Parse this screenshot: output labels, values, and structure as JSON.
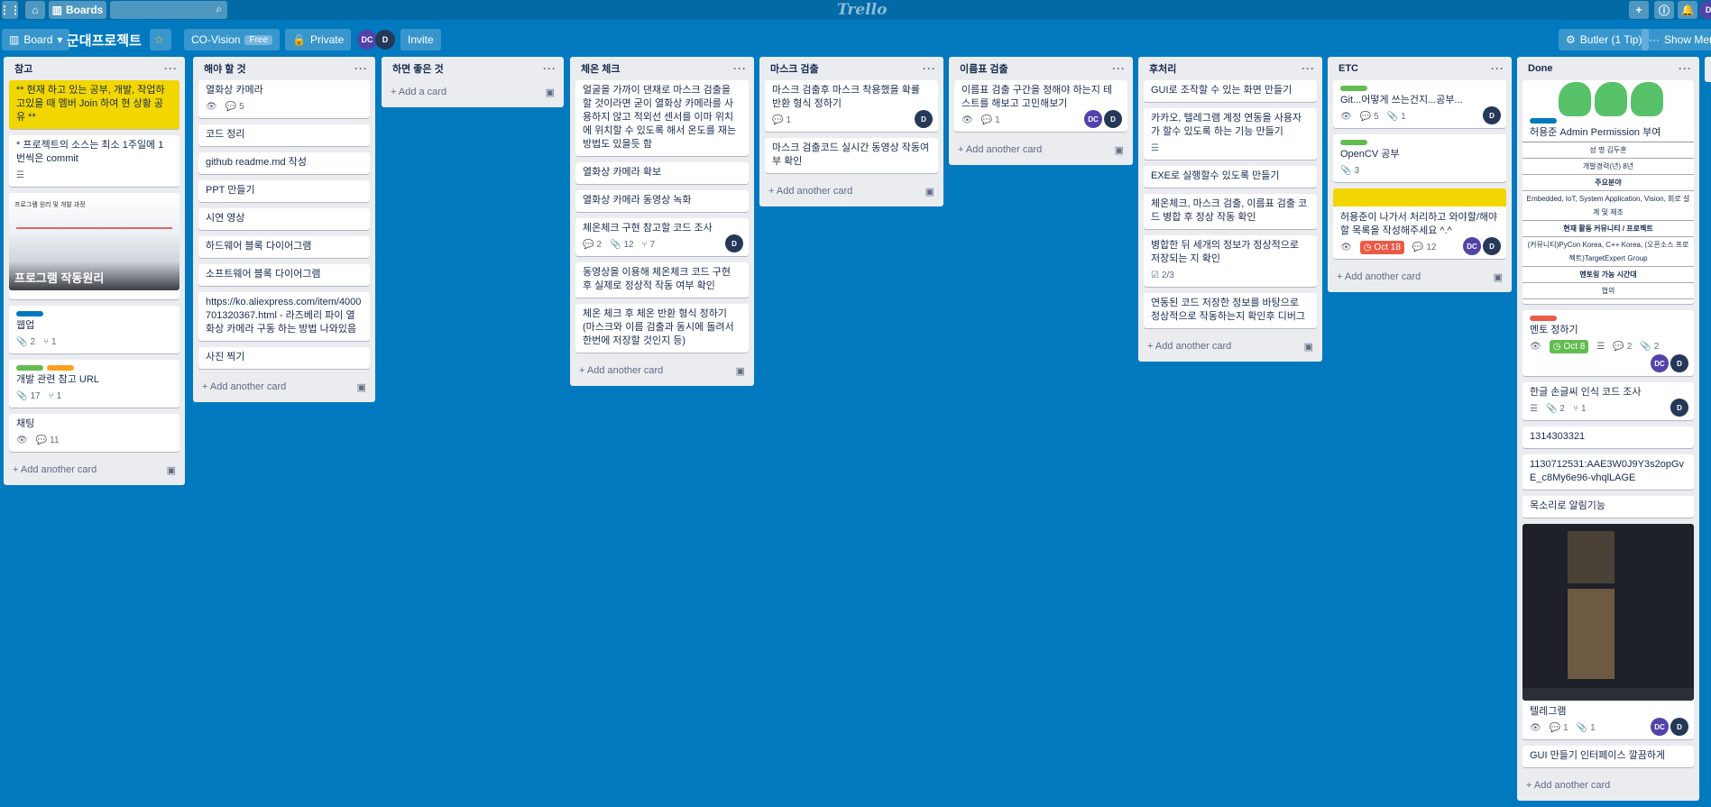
{
  "topbar": {
    "boards_label": "Boards",
    "logo": "Trello"
  },
  "board": {
    "view_label": "Board",
    "title": "군대프로젝트",
    "team": "CO-Vision",
    "team_badge": "Free",
    "privacy": "Private",
    "members": [
      "DC",
      "D"
    ],
    "invite": "Invite",
    "butler": "Butler (1 Tip)",
    "show_menu": "Show Menu"
  },
  "lists": [
    {
      "title": "참고",
      "add_label": "Add another card",
      "cards": [
        {
          "text": "** 현재 하고 있는 공부, 개발, 작업하고있을 때 멤버 Join 하여 현 상황 공유 **"
        },
        {
          "text": "* 프로젝트의 소스는 최소 1주일에 1번씩은 commit"
        },
        {
          "text": "",
          "cover_text": "프로그램 작동원리",
          "cover_title": "프로그램 원리 및 개발 과정"
        },
        {
          "text": "웹업",
          "badges": [
            "2",
            "1"
          ]
        },
        {
          "text": "개발 관련 참고 URL",
          "badges": [
            "17",
            "1"
          ]
        },
        {
          "text": "채팅",
          "badges": [
            "11"
          ]
        }
      ]
    },
    {
      "title": "해야 할 것",
      "add_label": "Add another card",
      "cards": [
        {
          "text": "열화상 카메라",
          "badges": [
            "5"
          ]
        },
        {
          "text": "코드 정리"
        },
        {
          "text": "github readme.md 작성"
        },
        {
          "text": "PPT 만들기"
        },
        {
          "text": "시연 영상"
        },
        {
          "text": "하드웨어 블록 다이어그램"
        },
        {
          "text": "소프트웨어 블록 다이어그램"
        },
        {
          "text": "https://ko.aliexpress.com/item/4000701320367.html - 라즈베리 파이 열화상 카메라 구동 하는 방법 나와있음"
        },
        {
          "text": "사진 찍기"
        }
      ]
    },
    {
      "title": "하면 좋은 것",
      "add_label": "Add a card",
      "cards": []
    },
    {
      "title": "체온 체크",
      "add_label": "Add another card",
      "cards": [
        {
          "text": "얼굴을 가까이 댄채로 마스크 검출을 할 것이라면 굳이 열화상 카메라를 사용하지 않고 적외선 센서를 이마 위치에 위치할 수 있도록 해서 온도를 재는 방법도 있을듯 함"
        },
        {
          "text": "열화상 카메라 확보"
        },
        {
          "text": "열화상 카메라 동영상 녹화"
        },
        {
          "text": "체온체크 구현 참고할 코드 조사",
          "badges": [
            "2",
            "12",
            "7"
          ],
          "member": "D"
        },
        {
          "text": "동영상을 이용해 체온체크 코드 구현 후 실제로 정상적 작동 여부 확인"
        },
        {
          "text": "체온 체크 후 체온 반환 형식 정하기 (마스크와 이름 검출과 동시에 돌려서 한번에 저장할 것인지 등)"
        }
      ]
    },
    {
      "title": "마스크 검출",
      "add_label": "Add another card",
      "cards": [
        {
          "text": "마스크 검출후 마스크 착용했을 확률 반환 형식 정하기",
          "badges": [
            "1"
          ],
          "member": "D"
        },
        {
          "text": "마스크 검출코드 실시간 동영상 작동여부 확인"
        }
      ]
    },
    {
      "title": "이름표 검출",
      "add_label": "Add another card",
      "cards": [
        {
          "text": "이름표 검출 구간을 정해야 하는지 테스트를 해보고 고민해보기",
          "badges": [
            "1"
          ],
          "members": [
            "DC",
            "D"
          ]
        }
      ]
    },
    {
      "title": "후처리",
      "add_label": "Add another card",
      "cards": [
        {
          "text": "GUI로 조작할 수 있는 화면 만들기"
        },
        {
          "text": "카카오, 텔레그램 계정 연동을 사용자가 할수 있도록 하는 기능 만들기"
        },
        {
          "text": "EXE로 실행할수 있도록 만들기"
        },
        {
          "text": "체온체크, 마스크 검출, 이름표 검출 코드 병합 후 정상 작동 확인"
        },
        {
          "text": "병합한 뒤 세개의 정보가 정상적으로 저장되는 지 확인",
          "badges": [
            "2/3"
          ]
        },
        {
          "text": "연동된 코드 저장한 정보를 바탕으로 정상적으로 작동하는지 확인후 디버그"
        }
      ]
    },
    {
      "title": "ETC",
      "add_label": "Add another card",
      "cards": [
        {
          "text": "Git...어떻게 쓰는건지...공부...",
          "badges": [
            "5",
            "1"
          ],
          "member": "D"
        },
        {
          "text": "OpenCV 공부",
          "badges": [
            "3"
          ]
        },
        {
          "text": "허용준이 나가서 처리하고 와야할/해야 할 목록을 작성해주세요 ^.^",
          "due": "Oct 18",
          "badges": [
            "12"
          ],
          "members": [
            "DC",
            "D"
          ]
        }
      ]
    },
    {
      "title": "Done",
      "add_label": "Add another card",
      "cards": [
        {
          "text": "허용준 Admin Permission 부여",
          "table": [
            "성 명 김두훈",
            "개발경력(년) 8년",
            "주요분야",
            "Embedded, IoT, System Application, Vision, 회로 설계 및 제조",
            "현재 활동 커뮤니티 / 프로젝트",
            "(커뮤니티)PyCon Korea, C++ Korea, (오픈소스 프로젝트)TargetExpert Group",
            "멘토링 가능 시간대",
            "협의"
          ]
        },
        {
          "text": "멘토 정하기",
          "due": "Oct 8",
          "badges": [
            "2",
            "2"
          ],
          "members": [
            "DC",
            "D"
          ]
        },
        {
          "text": "한글 손글씨 인식 코드 조사",
          "badges": [
            "2",
            "1"
          ],
          "member": "D"
        },
        {
          "text": "1314303321"
        },
        {
          "text": "1130712531:AAE3W0J9Y3s2opGvE_c8My6e96-vhqlLAGE"
        },
        {
          "text": "목소리로 알림기능"
        },
        {
          "text": "텔레그램",
          "badges": [
            "1",
            "1"
          ],
          "members": [
            "DC",
            "D"
          ]
        },
        {
          "text": "GUI 만들기 인터페이스 깔끔하게"
        }
      ]
    }
  ],
  "colors": {
    "background": "#0079bf",
    "label_blue": "#0079bf",
    "label_green": "#61bd4f",
    "label_orange": "#ff9f1a",
    "label_red": "#eb5a46",
    "label_yellow": "#f2d600"
  }
}
